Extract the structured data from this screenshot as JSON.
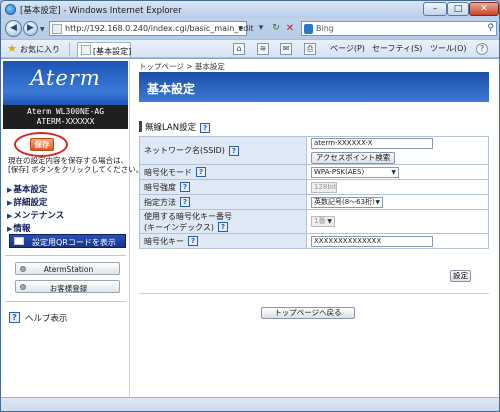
{
  "window": {
    "title": "[基本設定] - Windows Internet Explorer"
  },
  "nav": {
    "url": "http://192.168.0.240/index.cgi/basic_main_edit",
    "search_placeholder": "Bing"
  },
  "favorites": {
    "label": "お気に入り",
    "tab_label": "[基本設定]"
  },
  "toolbar": {
    "page": "ページ(P)",
    "safety": "セーフティ(S)",
    "tools": "ツール(O)",
    "help": "?"
  },
  "sidebar": {
    "logo": "Aterm",
    "model1": "Aterm WL300NE-AG",
    "model2": "ATERM-XXXXXX",
    "save_label": "保存",
    "save_note1": "現在の設定内容を保存する場合は、",
    "save_note2": "[保存] ボタンをクリックしてください。",
    "menu": [
      {
        "label": "基本設定"
      },
      {
        "label": "詳細設定"
      },
      {
        "label": "メンテナンス"
      },
      {
        "label": "情報"
      }
    ],
    "qr_label": "設定用QRコードを表示",
    "station_label": "AtermStation",
    "register_label": "お客様登録",
    "help_label": "ヘルプ表示"
  },
  "main": {
    "breadcrumb": "トップページ > 基本設定",
    "title": "基本設定",
    "section": "無線LAN設定",
    "rows": {
      "ssid_label": "ネットワーク名(SSID)",
      "ssid_value": "aterm-XXXXXX-X",
      "ap_search_label": "アクセスポイント検索",
      "enc_mode_label": "暗号化モード",
      "enc_mode_value": "WPA-PSK(AES)",
      "strength_label": "暗号強度",
      "strength_value": "128bit",
      "method_label": "指定方法",
      "method_value": "英数記号(8～63桁)",
      "key_index_label1": "使用する暗号化キー番号",
      "key_index_label2": "(キーインデックス)",
      "key_index_value": "1番",
      "key_label": "暗号化キー",
      "key_value": "XXXXXXXXXXXXXX"
    },
    "set_label": "設定",
    "top_label": "トップページへ戻る"
  }
}
